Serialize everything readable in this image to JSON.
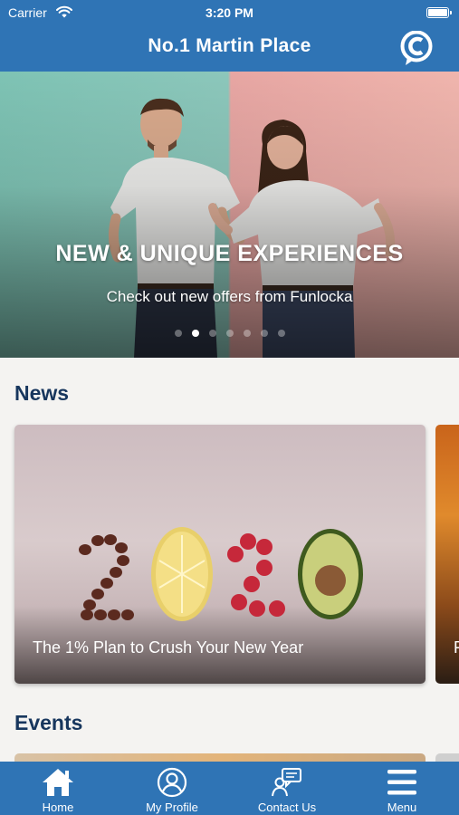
{
  "status_bar": {
    "carrier": "Carrier",
    "time": "3:20 PM"
  },
  "header": {
    "title": "No.1 Martin Place",
    "logo_icon": "c-brand-logo-icon"
  },
  "hero": {
    "title": "NEW & UNIQUE EXPERIENCES",
    "subtitle": "Check out new offers from Funlocka",
    "slide_count": 7,
    "active_slide": 2
  },
  "news": {
    "title": "News",
    "cards": [
      {
        "caption": "The 1% Plan to Crush Your New Year"
      },
      {
        "caption": "F"
      }
    ]
  },
  "events": {
    "title": "Events"
  },
  "tabbar": {
    "tabs": [
      {
        "label": "Home",
        "icon": "home-icon"
      },
      {
        "label": "My Profile",
        "icon": "profile-icon"
      },
      {
        "label": "Contact Us",
        "icon": "contact-icon"
      },
      {
        "label": "Menu",
        "icon": "hamburger-menu-icon"
      }
    ]
  },
  "colors": {
    "brand_blue": "#2f74b5",
    "heading_navy": "#17365d",
    "background": "#f4f3f1"
  }
}
